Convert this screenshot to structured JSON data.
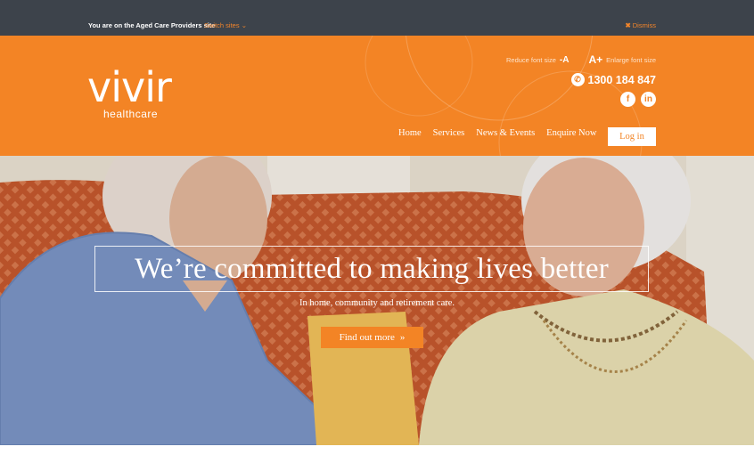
{
  "topbar": {
    "message": "You are on the Aged Care Providers site",
    "switch_label": "Switch sites",
    "switch_icon": "chevron-down-icon",
    "dismiss_label": "Dismiss",
    "dismiss_icon": "close-icon"
  },
  "header": {
    "logo_word": "vivir",
    "logo_sub": "healthcare",
    "reduce_label": "Reduce font size",
    "reduce_button": "-A",
    "enlarge_button": "A+",
    "enlarge_label": "Enlarge font size",
    "phone": "1300 184 847",
    "phone_icon": "phone-icon",
    "social": [
      "f",
      "in"
    ]
  },
  "nav": {
    "items": [
      "Home",
      "Services",
      "News & Events",
      "Enquire Now"
    ],
    "login": "Log in"
  },
  "hero": {
    "headline": "We’re committed to making lives better",
    "subline": "In home, community and retirement care.",
    "cta": "Find out more",
    "cta_icon": "»"
  },
  "colors": {
    "brand_orange": "#f38425",
    "topbar": "#3d434b"
  }
}
